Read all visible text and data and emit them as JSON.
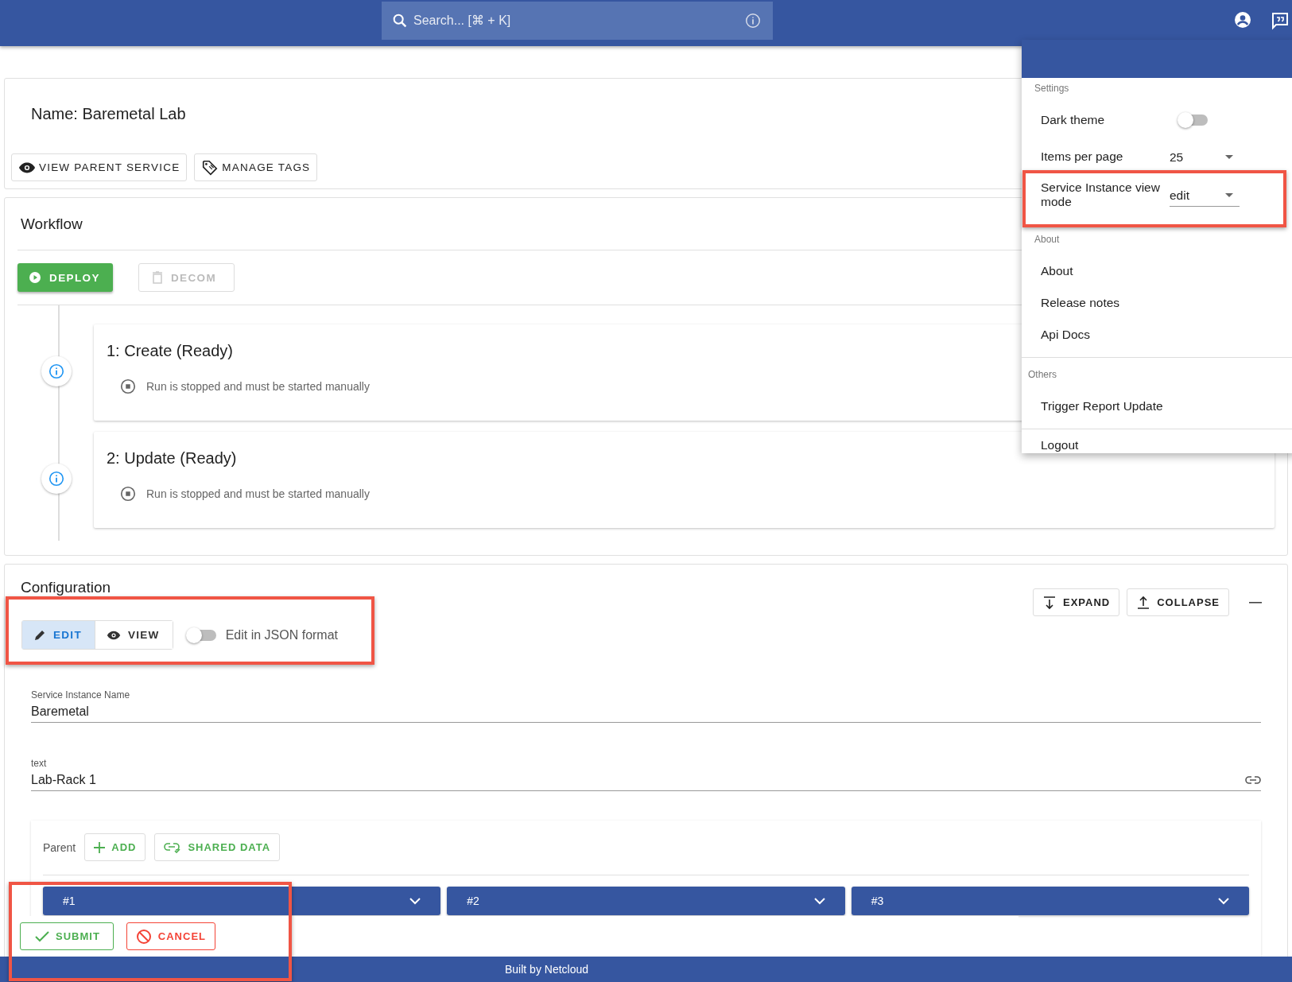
{
  "header": {
    "search": {
      "placeholder": "Search... [⌘ + K]"
    }
  },
  "title": "Name: Baremetal Lab",
  "actions": [
    {
      "label": "VIEW PARENT SERVICE"
    },
    {
      "label": "MANAGE TAGS"
    }
  ],
  "workflow": {
    "title": "Workflow",
    "buttons": [
      {
        "label": "DEPLOY",
        "disabled": false
      },
      {
        "label": "DECOM",
        "disabled": true
      }
    ],
    "steps": [
      {
        "title": "1: Create (Ready)",
        "status": "Run is stopped and must be started manually"
      },
      {
        "title": "2: Update (Ready)",
        "status": "Run is stopped and must be started manually"
      }
    ]
  },
  "configuration": {
    "title": "Configuration",
    "tools": [
      {
        "label": "EXPAND"
      },
      {
        "label": "COLLAPSE"
      }
    ],
    "modes": [
      {
        "label": "EDIT",
        "selected": true
      },
      {
        "label": "VIEW",
        "selected": false
      }
    ],
    "json_toggle": {
      "label": "Edit in JSON format",
      "on": false
    },
    "fields": [
      {
        "label": "Service Instance Name",
        "value": "Baremetal",
        "link": false
      },
      {
        "label": "text",
        "value": "Lab-Rack 1",
        "link": true
      }
    ],
    "parent": {
      "label": "Parent",
      "buttons": [
        {
          "label": "ADD"
        },
        {
          "label": "SHARED DATA"
        }
      ],
      "items": [
        {
          "label": "#1"
        },
        {
          "label": "#2"
        },
        {
          "label": "#3"
        }
      ]
    }
  },
  "form_actions": [
    {
      "label": "SUBMIT",
      "kind": "submit"
    },
    {
      "label": "CANCEL",
      "kind": "cancel"
    }
  ],
  "footer": "Built by Netcloud",
  "menu": {
    "sections": [
      {
        "title": "Settings",
        "items": [
          {
            "kind": "toggle",
            "label": "Dark theme",
            "on": false
          },
          {
            "kind": "select",
            "label": "Items per page",
            "value": "25"
          },
          {
            "kind": "select",
            "label": "Service Instance view mode",
            "value": "edit"
          }
        ]
      },
      {
        "title": "About",
        "items": [
          {
            "kind": "link",
            "label": "About"
          },
          {
            "kind": "link",
            "label": "Release notes"
          },
          {
            "kind": "link",
            "label": "Api Docs"
          }
        ]
      },
      {
        "title": "Others",
        "items": [
          {
            "kind": "link",
            "label": "Trigger Report Update"
          }
        ]
      }
    ],
    "logout": "Logout"
  }
}
